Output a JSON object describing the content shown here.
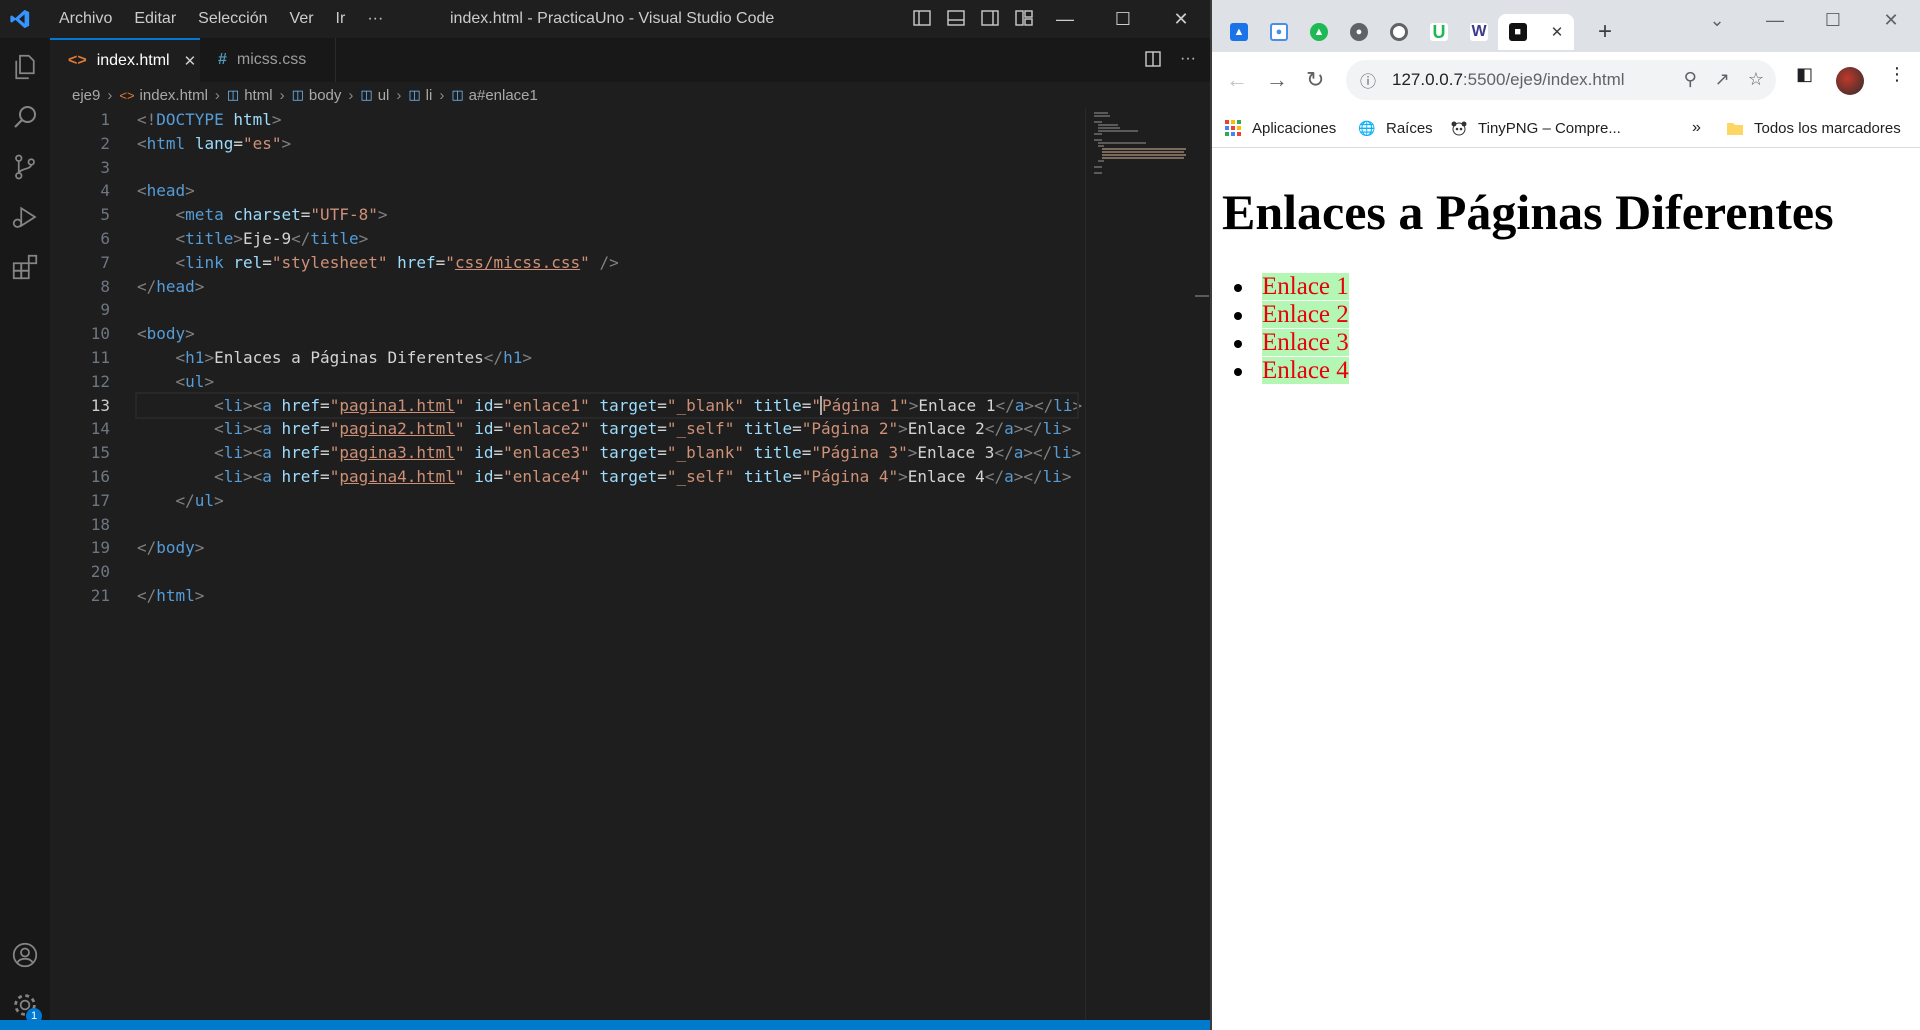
{
  "vscode": {
    "menu": [
      "Archivo",
      "Editar",
      "Selección",
      "Ver",
      "Ir",
      "···"
    ],
    "window_title": "index.html - PracticaUno - Visual Studio Code",
    "tabs": [
      {
        "label": "index.html",
        "icon": "<>",
        "active": true,
        "close": "✕"
      },
      {
        "label": "micss.css",
        "icon": "#",
        "active": false
      }
    ],
    "breadcrumb": [
      "eje9",
      "index.html",
      "html",
      "body",
      "ul",
      "li",
      "a#enlace1"
    ],
    "current_line": 13,
    "line_numbers": [
      "1",
      "2",
      "3",
      "4",
      "5",
      "6",
      "7",
      "8",
      "9",
      "10",
      "11",
      "12",
      "13",
      "14",
      "15",
      "16",
      "17",
      "18",
      "19",
      "20",
      "21"
    ],
    "activity_badge": "1",
    "colors": {
      "accent": "#0078d4",
      "status_bar": "#007acc"
    }
  },
  "chrome": {
    "tab_close": "✕",
    "new_tab": "+",
    "url_host": "127.0.0.7",
    "url_path": ":5500/eje9/index.html",
    "bookmarks": [
      {
        "label": "Aplicaciones",
        "icon": "apps-grid-icon"
      },
      {
        "label": "Raíces",
        "icon": "globe-icon"
      },
      {
        "label": "TinyPNG – Compre...",
        "icon": "panda-icon"
      }
    ],
    "bookmarks_more": "»",
    "all_bookmarks": "Todos los marcadores",
    "page": {
      "heading": "Enlaces a Páginas Diferentes",
      "links": [
        "Enlace 1",
        "Enlace 2",
        "Enlace 3",
        "Enlace 4"
      ],
      "link_color": "#e8000b",
      "link_bg": "#b4f7b4"
    }
  }
}
